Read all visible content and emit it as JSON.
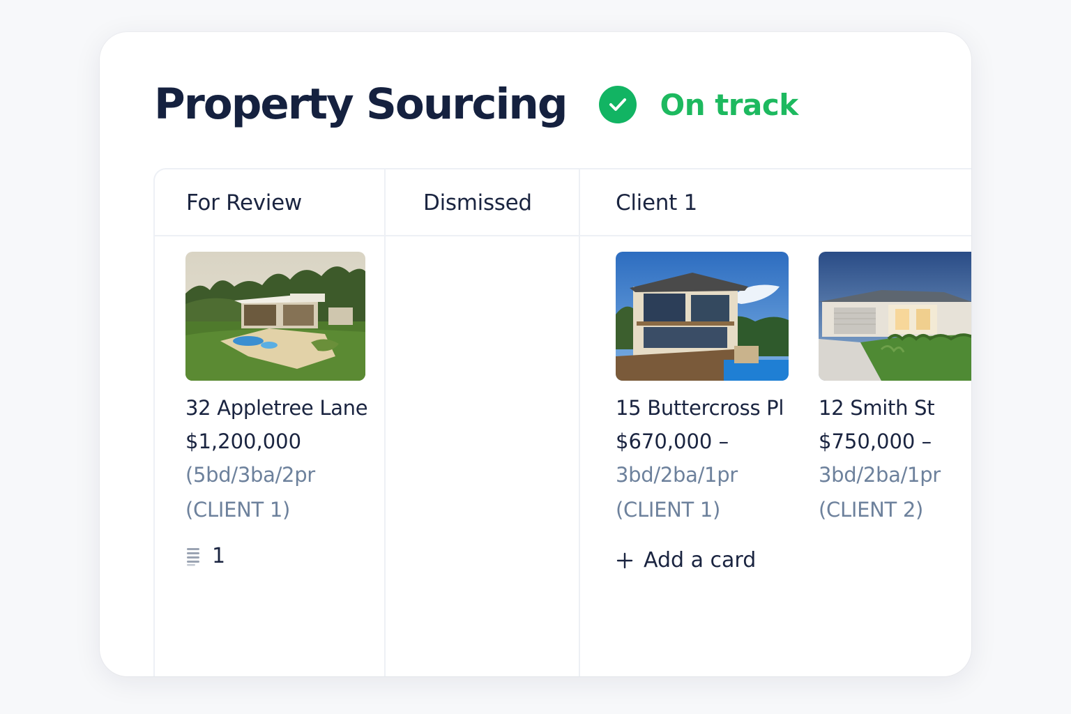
{
  "board_title": "Property Sourcing",
  "status": {
    "label": "On track",
    "icon": "check-circle-icon",
    "color": "#12b463"
  },
  "columns": [
    {
      "title": "For Review",
      "cards": [
        {
          "address": "32 Appletree Lane",
          "price": "$1,200,000",
          "specs": "(5bd/3ba/2pr",
          "client": "(CLIENT 1)",
          "description_count": "1"
        }
      ]
    },
    {
      "title": "Dismissed",
      "cards": []
    },
    {
      "title": "Client 1",
      "cards": [
        {
          "address": "15 Buttercross Pl",
          "price": "$670,000 –",
          "specs": "3bd/2ba/1pr",
          "client": "(CLIENT 1)"
        },
        {
          "address": "12 Smith St",
          "price": "$750,000 –",
          "specs": "3bd/2ba/1pr",
          "client": "(CLIENT 2)"
        }
      ],
      "add_card_label": "Add a card"
    }
  ],
  "colors": {
    "title": "#15213f",
    "status_green": "#1db95f",
    "muted_text": "#6d819c",
    "divider": "#edf0f5"
  }
}
